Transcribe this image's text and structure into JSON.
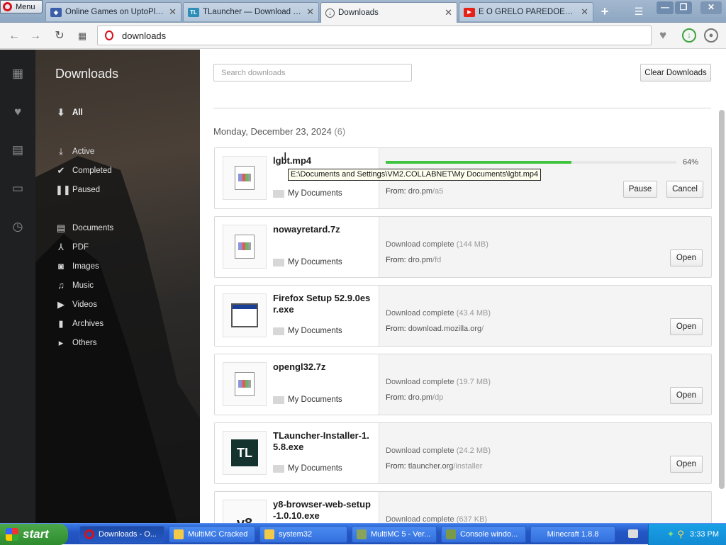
{
  "browser": {
    "menu_label": "Menu",
    "tabs": [
      {
        "title": "Online Games on UptoPlay —",
        "icon": "gamepad-icon",
        "active": false
      },
      {
        "title": "TLauncher — Download Mine",
        "icon": "tlauncher-icon",
        "active": false
      },
      {
        "title": "Downloads",
        "icon": "download-icon",
        "active": true
      },
      {
        "title": "E O GRELO PAREDOES - par",
        "icon": "youtube-icon",
        "active": false
      }
    ],
    "url": "downloads"
  },
  "sidebar_icons": [
    "speed-dial-icon",
    "heart-icon",
    "news-icon",
    "tabs-icon",
    "history-icon"
  ],
  "panel": {
    "title": "Downloads",
    "all_label": "All",
    "status_categories": [
      "Active",
      "Completed",
      "Paused"
    ],
    "type_categories": [
      "Documents",
      "PDF",
      "Images",
      "Music",
      "Videos",
      "Archives",
      "Others"
    ]
  },
  "main": {
    "search_placeholder": "Search downloads",
    "clear_label": "Clear Downloads",
    "date_header": "Monday, December 23, 2024",
    "date_count": "(6)"
  },
  "downloads": [
    {
      "name": "lgbt.mp4",
      "folder": "My Documents",
      "from_label": "From:",
      "from_domain": "dro.pm",
      "from_path": "/a5",
      "progress": 0.64,
      "progress_label": "64%",
      "pause_label": "Pause",
      "cancel_label": "Cancel"
    },
    {
      "name": "nowayretard.7z",
      "folder": "My Documents",
      "status": "Download complete",
      "size": "(144 MB)",
      "from_label": "From:",
      "from_domain": "dro.pm",
      "from_path": "/fd",
      "open_label": "Open"
    },
    {
      "name": "Firefox Setup 52.9.0esr.exe",
      "folder": "My Documents",
      "status": "Download complete",
      "size": "(43.4 MB)",
      "from_label": "From:",
      "from_domain": "download.mozilla.org",
      "from_path": "/",
      "open_label": "Open"
    },
    {
      "name": "opengl32.7z",
      "folder": "My Documents",
      "status": "Download complete",
      "size": "(19.7 MB)",
      "from_label": "From:",
      "from_domain": "dro.pm",
      "from_path": "/dp",
      "open_label": "Open"
    },
    {
      "name": "TLauncher-Installer-1.5.8.exe",
      "folder": "My Documents",
      "status": "Download complete",
      "size": "(24.2 MB)",
      "from_label": "From:",
      "from_domain": "tlauncher.org",
      "from_path": "/installer",
      "open_label": "Open"
    },
    {
      "name": "y8-browser-web-setup-1.0.10.exe",
      "status": "Download complete",
      "size": "(637 KB)"
    }
  ],
  "tooltip": "E:\\Documents and Settings\\VM2.COLLABNET\\My Documents\\lgbt.mp4",
  "icon_text": {
    "tlauncher": "TL",
    "y8": "v8"
  },
  "taskbar": {
    "start_label": "start",
    "items": [
      "Downloads - O...",
      "MultiMC Cracked",
      "system32",
      "MultiMC 5 - Ver...",
      "Console windo...",
      "Minecraft 1.8.8"
    ],
    "clock": "3:33 PM"
  },
  "colors": {
    "progress": "#3ec43e",
    "opera_red": "#d5121c",
    "taskbar_blue": "#2457c5",
    "start_green": "#3a9a3a"
  }
}
